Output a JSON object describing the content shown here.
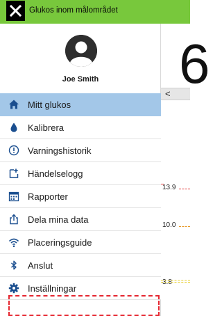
{
  "topbar": {
    "title": "Glukos inom målområdet",
    "close_icon": "close-icon",
    "color": "#78c83c"
  },
  "background": {
    "reading": "6",
    "back_glyph": "<",
    "ticks": [
      "13.9",
      "10.0",
      "3.8"
    ]
  },
  "profile": {
    "name": "Joe Smith",
    "avatar_icon": "person-avatar-icon"
  },
  "menu": {
    "items": [
      {
        "label": "Mitt glukos",
        "icon": "home-icon",
        "active": true
      },
      {
        "label": "Kalibrera",
        "icon": "drop-icon"
      },
      {
        "label": "Varningshistorik",
        "icon": "alert-circle-icon"
      },
      {
        "label": "Händelselogg",
        "icon": "add-note-icon"
      },
      {
        "label": "Rapporter",
        "icon": "calendar-icon"
      },
      {
        "label": "Dela mina data",
        "icon": "share-icon"
      },
      {
        "label": "Placeringsguide",
        "icon": "signal-icon"
      },
      {
        "label": "Anslut",
        "icon": "bluetooth-icon"
      },
      {
        "label": "Inställningar",
        "icon": "gear-icon"
      }
    ],
    "active_color": "#a3c7e8",
    "icon_color": "#1a4e8f"
  },
  "annotation": {
    "color": "#e52630"
  }
}
